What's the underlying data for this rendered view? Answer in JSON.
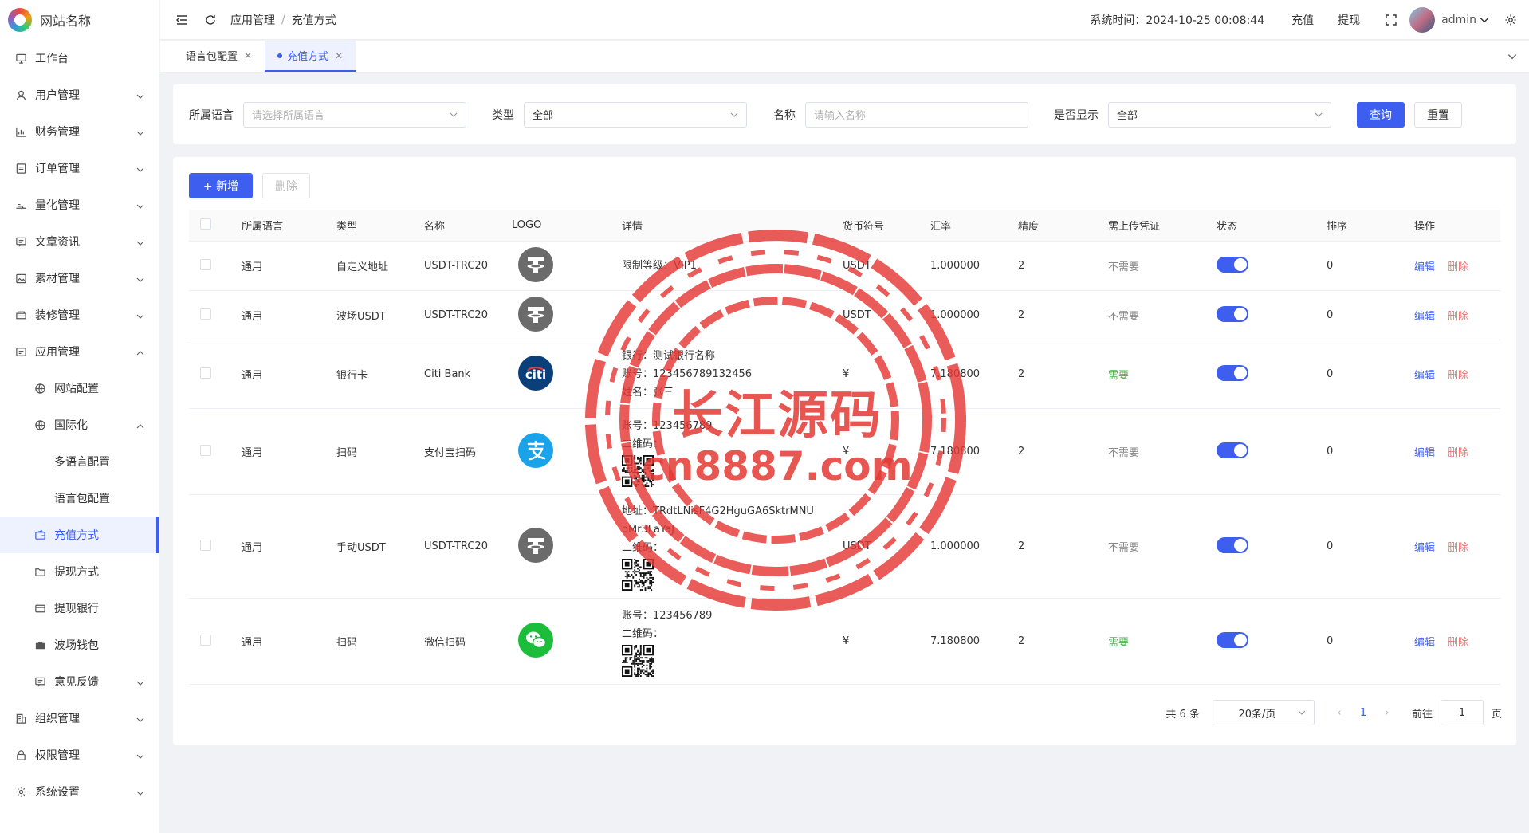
{
  "site": {
    "name": "网站名称"
  },
  "sidebar": {
    "items": [
      {
        "label": "工作台",
        "icon": "monitor-icon"
      },
      {
        "label": "用户管理",
        "icon": "user-icon"
      },
      {
        "label": "财务管理",
        "icon": "chart-icon"
      },
      {
        "label": "订单管理",
        "icon": "order-icon"
      },
      {
        "label": "量化管理",
        "icon": "bot-icon"
      },
      {
        "label": "文章资讯",
        "icon": "message-icon"
      },
      {
        "label": "素材管理",
        "icon": "image-icon"
      },
      {
        "label": "装修管理",
        "icon": "box-icon"
      },
      {
        "label": "应用管理",
        "icon": "app-icon"
      },
      {
        "label": "网站配置",
        "icon": "globe-icon"
      },
      {
        "label": "国际化",
        "icon": "globe-icon"
      },
      {
        "label": "多语言配置"
      },
      {
        "label": "语言包配置"
      },
      {
        "label": "充值方式",
        "icon": "wallet-icon"
      },
      {
        "label": "提现方式",
        "icon": "folder-icon"
      },
      {
        "label": "提现银行",
        "icon": "card-icon"
      },
      {
        "label": "波场钱包",
        "icon": "camera-icon"
      },
      {
        "label": "意见反馈",
        "icon": "message-icon"
      },
      {
        "label": "组织管理",
        "icon": "building-icon"
      },
      {
        "label": "权限管理",
        "icon": "lock-icon"
      },
      {
        "label": "系统设置",
        "icon": "gear-icon"
      }
    ]
  },
  "header": {
    "breadcrumb": [
      "应用管理",
      "充值方式"
    ],
    "system_time_label": "系统时间：",
    "system_time": "2024-10-25 00:08:44",
    "recharge": "充值",
    "withdraw": "提现",
    "user": "admin"
  },
  "tabs": [
    {
      "label": "语言包配置"
    },
    {
      "label": "充值方式"
    }
  ],
  "filter": {
    "lang_label": "所属语言",
    "lang_placeholder": "请选择所属语言",
    "type_label": "类型",
    "type_value": "全部",
    "name_label": "名称",
    "name_placeholder": "请输入名称",
    "show_label": "是否显示",
    "show_value": "全部",
    "query": "查询",
    "reset": "重置"
  },
  "toolbar": {
    "add": "+ 新增",
    "delete": "删除"
  },
  "table": {
    "columns": [
      "所属语言",
      "类型",
      "名称",
      "LOGO",
      "详情",
      "货币符号",
      "汇率",
      "精度",
      "需上传凭证",
      "状态",
      "排序",
      "操作"
    ],
    "edit": "编辑",
    "remove": "删除",
    "rows": [
      {
        "lang": "通用",
        "type": "自定义地址",
        "name": "USDT-TRC20",
        "logo": "tether-icon",
        "detail": [
          "限制等级：VIP1"
        ],
        "qr": false,
        "symbol": "USDT",
        "rate": "1.000000",
        "precision": "2",
        "voucher": "不需要",
        "need": false,
        "sort": "0"
      },
      {
        "lang": "通用",
        "type": "波场USDT",
        "name": "USDT-TRC20",
        "logo": "tether-icon",
        "detail": [],
        "qr": false,
        "symbol": "USDT",
        "rate": "1.000000",
        "precision": "2",
        "voucher": "不需要",
        "need": false,
        "sort": "0"
      },
      {
        "lang": "通用",
        "type": "银行卡",
        "name": "Citi Bank",
        "logo": "citi-icon",
        "detail": [
          "银行：测试银行名称",
          "账号：123456789132456",
          "姓名：张三"
        ],
        "qr": false,
        "symbol": "¥",
        "rate": "7.180800",
        "precision": "2",
        "voucher": "需要",
        "need": true,
        "sort": "0"
      },
      {
        "lang": "通用",
        "type": "扫码",
        "name": "支付宝扫码",
        "logo": "alipay-icon",
        "detail": [
          "账号：123456789",
          "二维码："
        ],
        "qr": true,
        "symbol": "¥",
        "rate": "7.180800",
        "precision": "2",
        "voucher": "不需要",
        "need": false,
        "sort": "0"
      },
      {
        "lang": "通用",
        "type": "手动USDT",
        "name": "USDT-TRC20",
        "logo": "tether-icon",
        "detail": [
          "地址：TRdtLNisF4G2HguGA6SktrMNU",
          "oMr3LaYaJ",
          "二维码："
        ],
        "qr": true,
        "symbol": "USDT",
        "rate": "1.000000",
        "precision": "2",
        "voucher": "不需要",
        "need": false,
        "sort": "0"
      },
      {
        "lang": "通用",
        "type": "扫码",
        "name": "微信扫码",
        "logo": "wechat-icon",
        "detail": [
          "账号：123456789",
          "二维码："
        ],
        "qr": true,
        "symbol": "¥",
        "rate": "7.180800",
        "precision": "2",
        "voucher": "需要",
        "need": true,
        "sort": "0"
      }
    ]
  },
  "pager": {
    "total": "共 6 条",
    "page_size": "20条/页",
    "current": "1",
    "goto_label": "前往",
    "goto_value": "1",
    "page_unit": "页"
  },
  "watermark": {
    "title": "长江源码",
    "url": "cn8887.com"
  },
  "colors": {
    "primary": "#3e5ef0",
    "danger": "#f56c6c",
    "success": "#4caf50",
    "stamp": "#e53935"
  }
}
